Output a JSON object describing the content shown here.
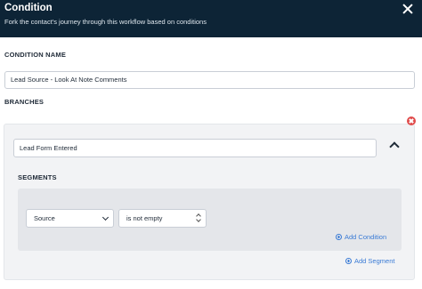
{
  "header": {
    "title": "Condition",
    "subtitle": "Fork the contact's journey through this workflow based on conditions",
    "close_icon": "close-icon"
  },
  "condition_name": {
    "label": "CONDITION NAME",
    "value": "Lead Source - Look At Note Comments"
  },
  "branches": {
    "label": "BRANCHES",
    "items": [
      {
        "name_value": "Lead Form Entered",
        "segments_label": "SEGMENTS",
        "conditions": [
          {
            "field": "Source",
            "operator": "is not empty"
          }
        ],
        "add_condition_label": "Add Condition",
        "add_segment_label": "Add Segment"
      }
    ]
  },
  "colors": {
    "header_bg": "#0d2436",
    "accent": "#3a7bd5",
    "danger": "#e04a4a"
  }
}
